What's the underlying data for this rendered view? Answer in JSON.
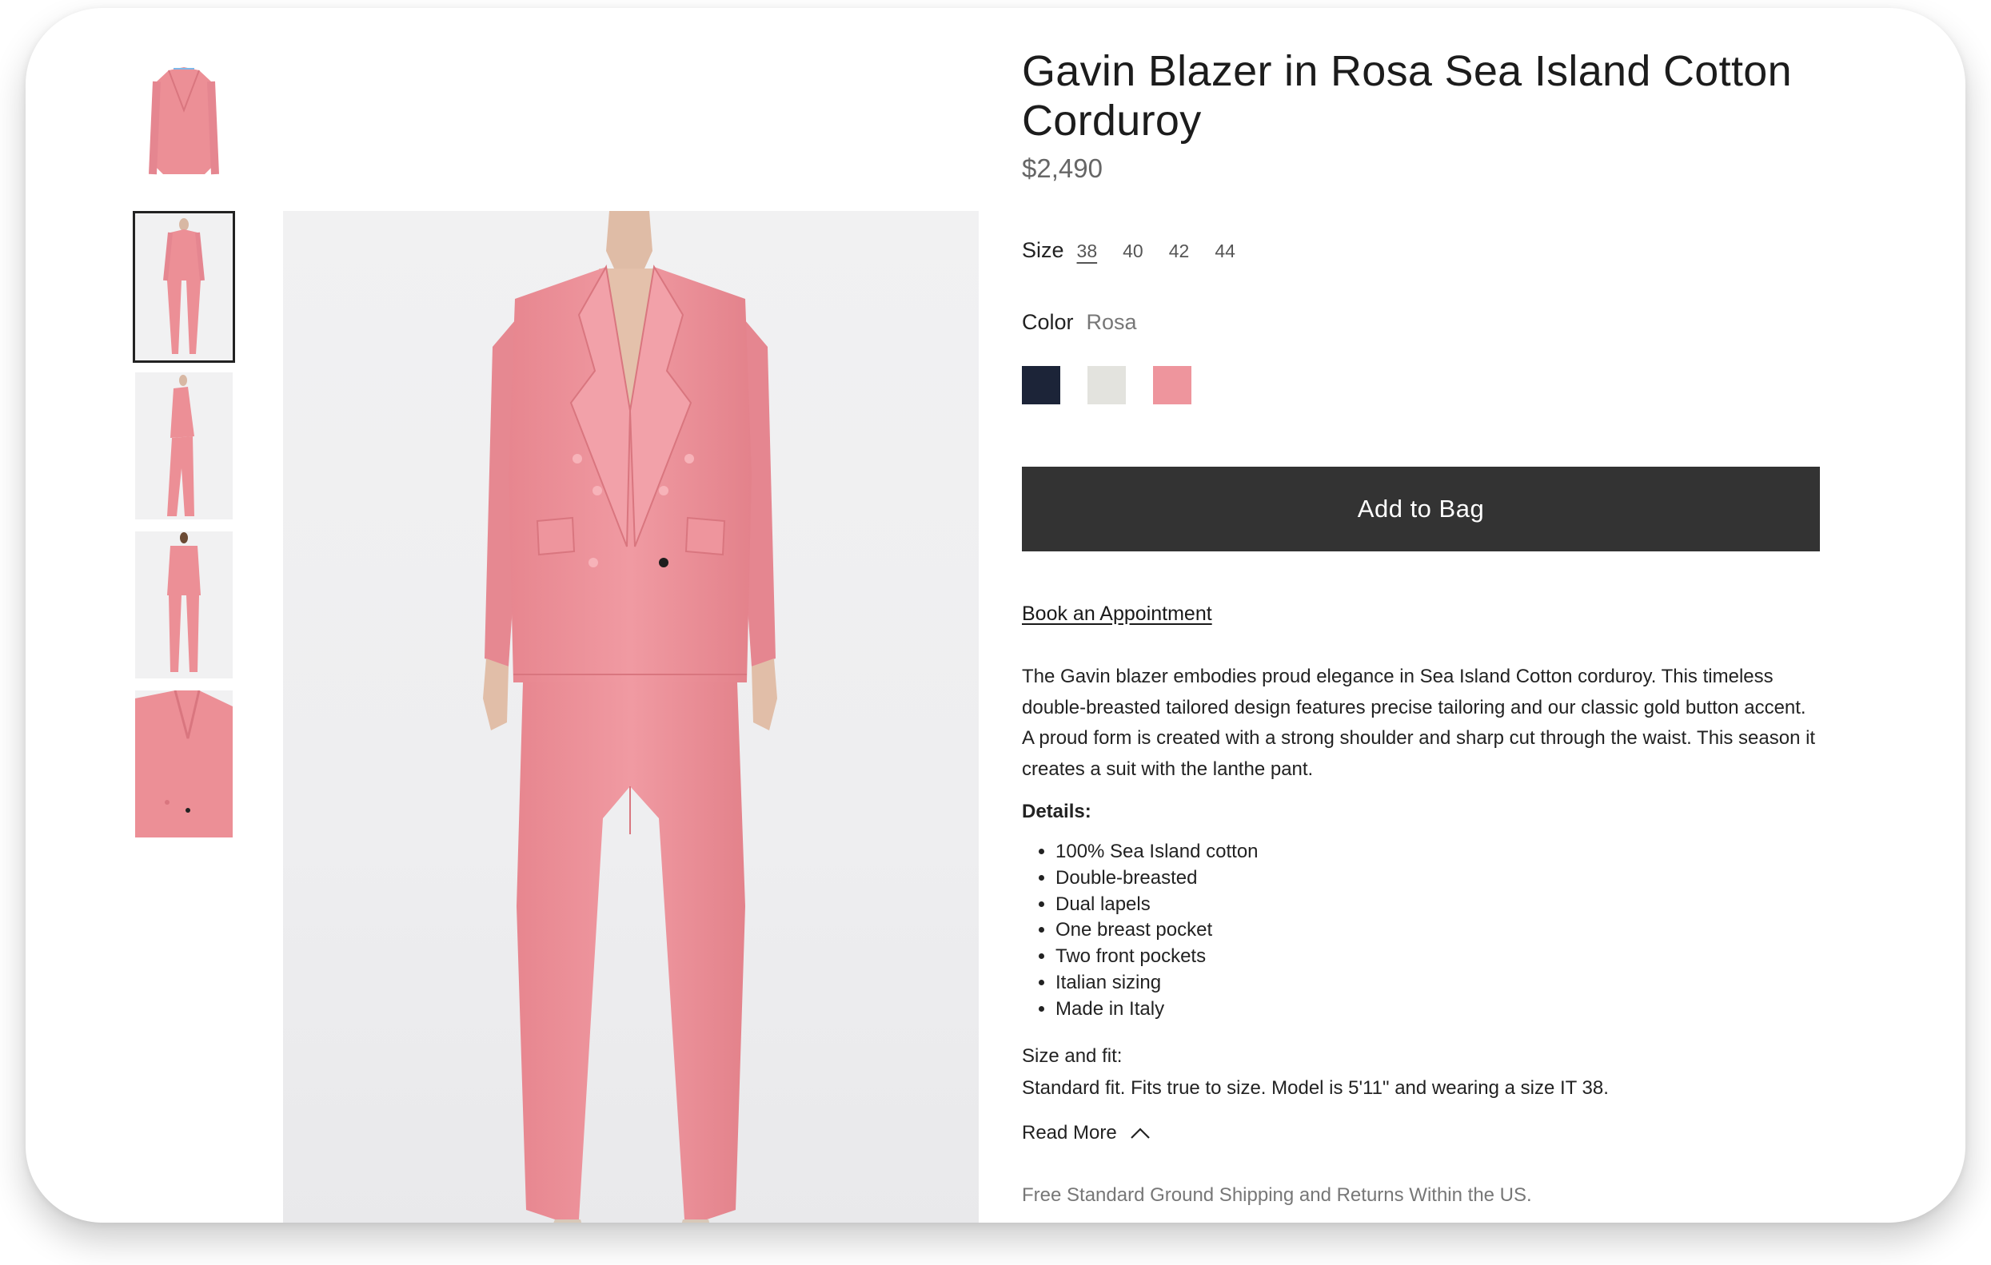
{
  "product": {
    "title": "Gavin Blazer in Rosa Sea Island Cotton Corduroy",
    "price": "$2,490"
  },
  "size": {
    "label": "Size",
    "options": [
      "38",
      "40",
      "42",
      "44"
    ],
    "selected": "38"
  },
  "color": {
    "label": "Color",
    "selected": "Rosa",
    "swatches": [
      {
        "name": "navy",
        "hex": "#1c2438"
      },
      {
        "name": "ivory",
        "hex": "#e3e3de"
      },
      {
        "name": "rosa",
        "hex": "#ee959d"
      }
    ]
  },
  "actions": {
    "add_to_bag": "Add to Bag",
    "book_appointment": "Book an Appointment",
    "read_more": "Read More"
  },
  "description": "The Gavin blazer embodies proud elegance in Sea Island Cotton corduroy. This timeless double-breasted tailored design features precise tailoring and our classic gold button accent. A proud form is created with a strong shoulder and sharp cut through the waist. This season it creates a suit with the lanthe pant.",
  "details": {
    "heading": "Details:",
    "items": [
      "100% Sea Island cotton",
      "Double-breasted",
      "Dual lapels",
      "One breast pocket",
      "Two front pockets",
      "Italian sizing",
      "Made in Italy"
    ]
  },
  "fit": {
    "heading": "Size and fit:",
    "text": "Standard fit. Fits true to size. Model is 5'11\" and wearing a size IT 38."
  },
  "shipping": "Free Standard Ground Shipping and Returns Within the US.",
  "gallery": {
    "thumbnails": [
      "blazer-flat",
      "suit-front",
      "suit-side",
      "suit-back",
      "blazer-closeup"
    ],
    "active_index": 1
  },
  "colors": {
    "pink": "#ec8f96",
    "pink_dark": "#d9767f",
    "button_bg": "#333333"
  }
}
